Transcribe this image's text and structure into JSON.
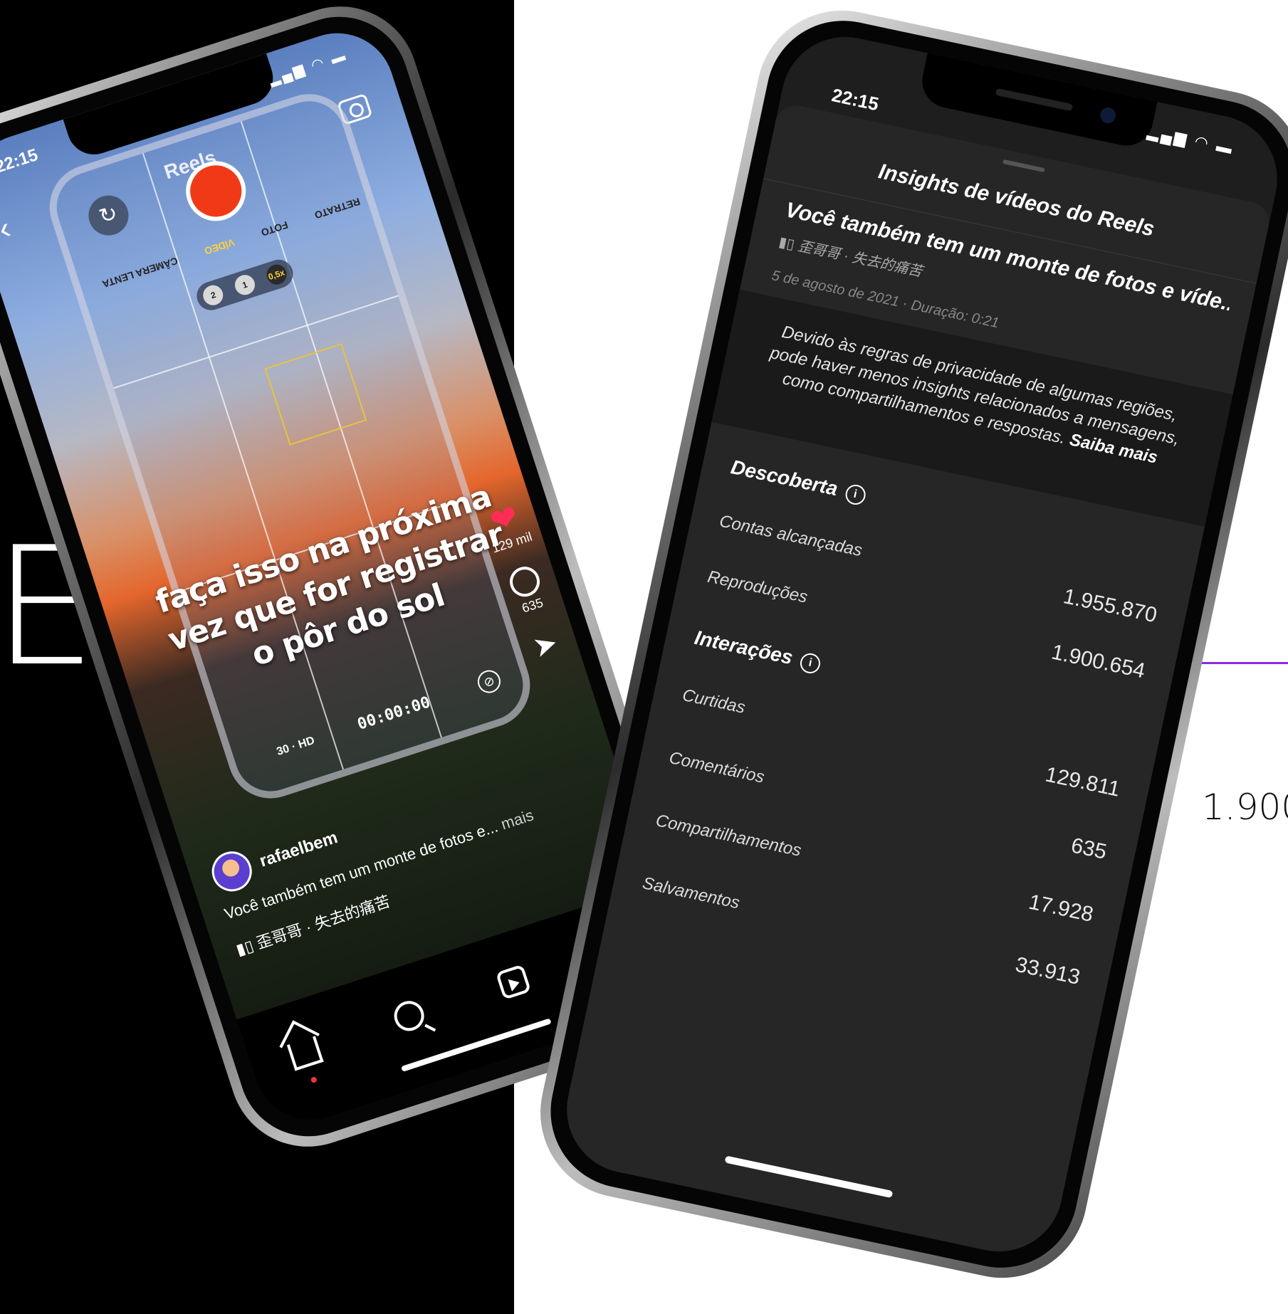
{
  "background": {
    "left_color": "#000000",
    "right_color": "#ffffff"
  },
  "decor": {
    "big_letters": "ES",
    "side_number": "1.900",
    "accent_line_color": "#8a2be2"
  },
  "reels_phone": {
    "status": {
      "time": "22:15",
      "icons": "▂▄▆ ◠ ▬"
    },
    "header": {
      "back_icon": "chevron-left-icon",
      "title": "Reels",
      "camera_icon": "camera-icon"
    },
    "camera_ui": {
      "modes": [
        "RETRATO",
        "FOTO",
        "VÍDEO",
        "CÂMERA LENTA"
      ],
      "active_mode": "VÍDEO",
      "zoom": [
        "2",
        "1",
        "0,5x"
      ],
      "resolution": "30 · HD",
      "timer": "00:00:00"
    },
    "overlay_caption": "faça isso na próxima vez que for registrar o pôr do sol",
    "actions": {
      "likes": "129 mil",
      "comments": "635"
    },
    "author": "rafaelbem",
    "caption": "Você também tem um monte de fotos e...",
    "caption_more": "mais",
    "music": "歪哥哥 · 失去的痛苦",
    "nav": [
      "home-icon",
      "search-icon",
      "reels-icon",
      "shop-icon"
    ]
  },
  "insights_phone": {
    "status": {
      "time": "22:15",
      "icons": "▂▄▆ ◠ ▬"
    },
    "title": "Insights de vídeos do Reels",
    "video_title": "Você também tem um monte de fotos e víde...",
    "music": "歪哥哥 · 失去的痛苦",
    "meta": "5 de agosto de 2021 · Duração: 0:21",
    "notice": "Devido às regras de privacidade de algumas regiões, pode haver menos insights relacionados a mensagens, como compartilhamentos e respostas.",
    "notice_link": "Saiba mais",
    "discovery": {
      "title": "Descoberta",
      "rows": [
        {
          "label": "Contas alcançadas",
          "value": "1.955.870"
        },
        {
          "label": "Reproduções",
          "value": "1.900.654"
        }
      ]
    },
    "interactions": {
      "title": "Interações",
      "rows": [
        {
          "label": "Curtidas",
          "value": "129.811"
        },
        {
          "label": "Comentários",
          "value": "635"
        },
        {
          "label": "Compartilhamentos",
          "value": "17.928"
        },
        {
          "label": "Salvamentos",
          "value": "33.913"
        }
      ]
    }
  }
}
